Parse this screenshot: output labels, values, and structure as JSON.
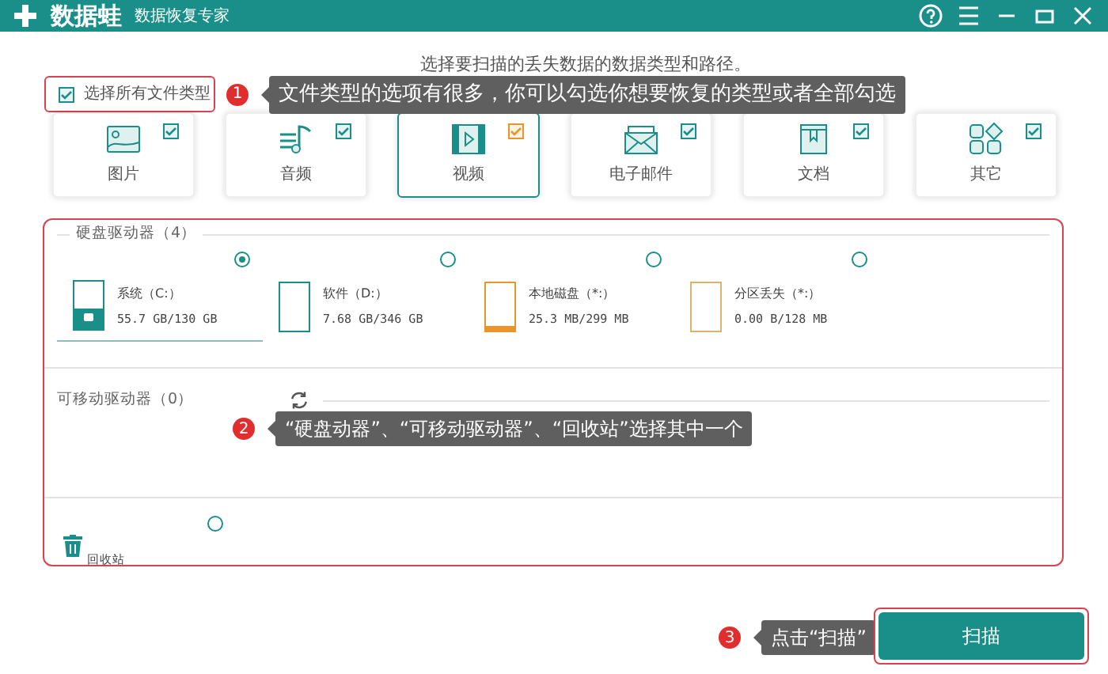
{
  "window": {
    "app_name": "数据蛙",
    "subtitle": "数据恢复专家"
  },
  "heading": "选择要扫描的丢失数据的数据类型和路径。",
  "select_all": {
    "label": "选择所有文件类型",
    "checked": true
  },
  "file_types": [
    {
      "label": "图片",
      "kind": "image",
      "checked": true,
      "selected": false
    },
    {
      "label": "音频",
      "kind": "audio",
      "checked": true,
      "selected": false
    },
    {
      "label": "视频",
      "kind": "video",
      "checked": true,
      "selected": true
    },
    {
      "label": "电子邮件",
      "kind": "email",
      "checked": true,
      "selected": false
    },
    {
      "label": "文档",
      "kind": "document",
      "checked": true,
      "selected": false
    },
    {
      "label": "其它",
      "kind": "other",
      "checked": true,
      "selected": false
    }
  ],
  "hard_drives": {
    "title": "硬盘驱动器（4）",
    "drives": [
      {
        "name": "系统（C:）",
        "usage": "55.7 GB/130 GB",
        "kind": "system",
        "color": "#1a8f8a",
        "level": 0.43,
        "selected": true
      },
      {
        "name": "软件（D:）",
        "usage": "7.68 GB/346 GB",
        "kind": "plain",
        "color": "#1a8f8a",
        "level": 0,
        "selected": false
      },
      {
        "name": "本地磁盘（*:）",
        "usage": "25.3 MB/299 MB",
        "kind": "plain",
        "color": "#e8952e",
        "level": 0.08,
        "selected": false
      },
      {
        "name": "分区丢失（*:）",
        "usage": "0.00  B/128 MB",
        "kind": "plain",
        "color": "#d9b46a",
        "level": 0,
        "selected": false
      }
    ]
  },
  "removable": {
    "title": "可移动驱动器（0）"
  },
  "recycle_bin": {
    "label": "回收站",
    "selected": false
  },
  "callouts": [
    {
      "number": "1",
      "text": "文件类型的选项有很多，你可以勾选你想要恢复的类型或者全部勾选"
    },
    {
      "number": "2",
      "text": "“硬盘动器”、“可移动驱动器”、“回收站”选择其中一个"
    },
    {
      "number": "3",
      "text": "点击“扫描”"
    }
  ],
  "scan_button": "扫描"
}
